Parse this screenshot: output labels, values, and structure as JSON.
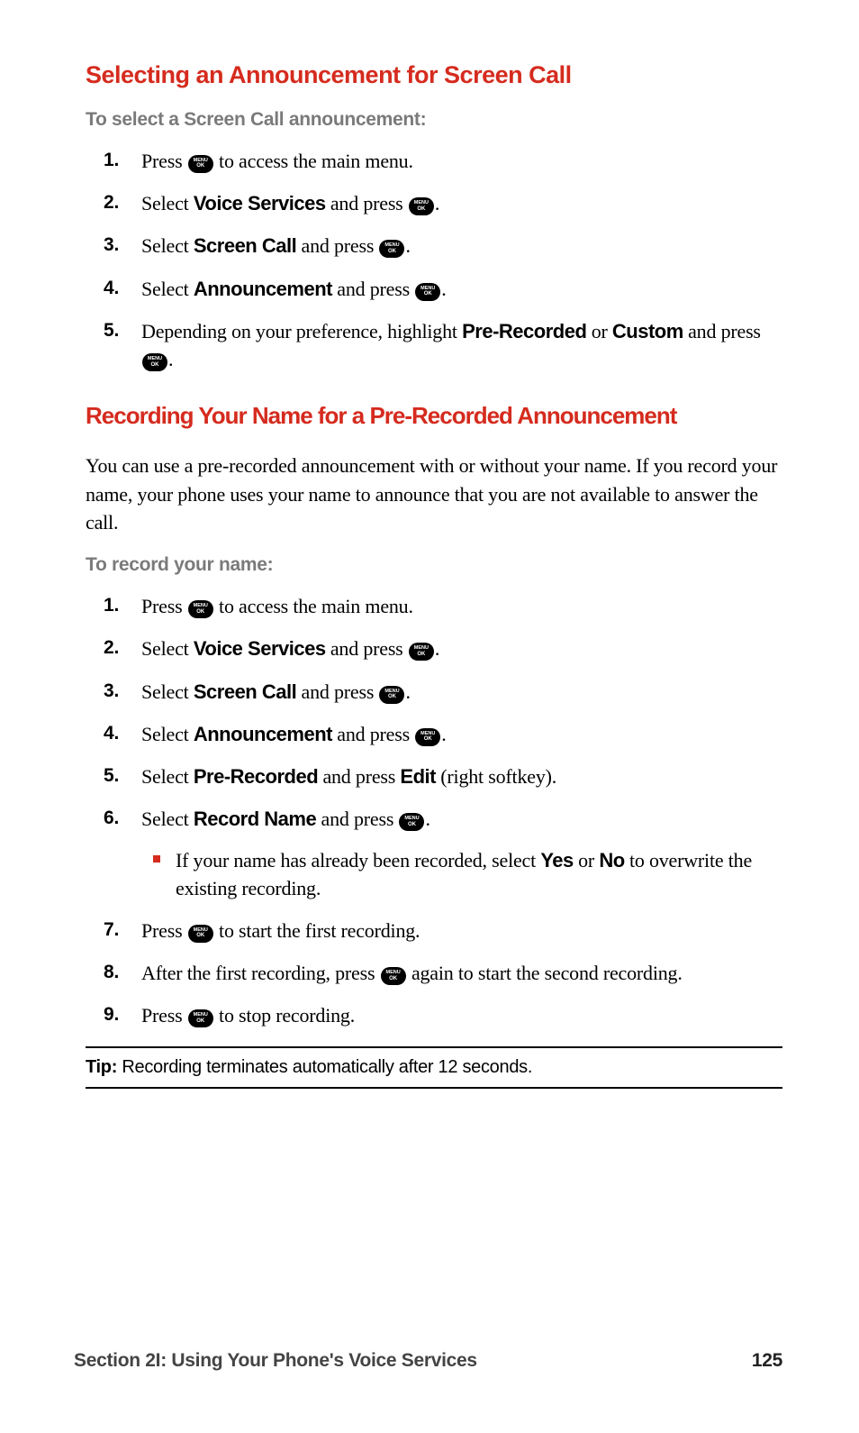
{
  "section1": {
    "heading": "Selecting an Announcement for Screen Call",
    "subhead": "To select a Screen Call announcement:",
    "steps": {
      "s1_a": "Press ",
      "s1_b": " to access the main menu.",
      "s2_a": "Select ",
      "s2_bold": "Voice Services",
      "s2_b": " and press ",
      "s2_c": ".",
      "s3_a": "Select ",
      "s3_bold": "Screen Call",
      "s3_b": " and press ",
      "s3_c": ".",
      "s4_a": "Select ",
      "s4_bold": "Announcement",
      "s4_b": " and press ",
      "s4_c": ".",
      "s5_a": "Depending on your preference, highlight ",
      "s5_bold1": "Pre-Recorded",
      "s5_b": " or ",
      "s5_bold2": "Custom",
      "s5_c": " and press ",
      "s5_d": "."
    }
  },
  "section2": {
    "heading": "Recording Your Name for a Pre-Recorded Announcement",
    "intro": "You can use a pre-recorded announcement with or without your name. If you record your name, your phone uses your name to announce that you are not available to answer the call.",
    "subhead": "To record your name:",
    "steps": {
      "s1_a": "Press ",
      "s1_b": " to access the main menu.",
      "s2_a": "Select ",
      "s2_bold": "Voice Services",
      "s2_b": " and press ",
      "s2_c": ".",
      "s3_a": "Select ",
      "s3_bold": "Screen Call",
      "s3_b": " and press ",
      "s3_c": ".",
      "s4_a": "Select ",
      "s4_bold": "Announcement",
      "s4_b": " and press ",
      "s4_c": ".",
      "s5_a": "Select ",
      "s5_bold1": "Pre-Recorded",
      "s5_b": " and press ",
      "s5_bold2": "Edit",
      "s5_c": " (right softkey).",
      "s6_a": "Select ",
      "s6_bold": "Record Name",
      "s6_b": " and press ",
      "s6_c": ".",
      "bullet_a": "If your name has already been recorded, select ",
      "bullet_bold1": "Yes",
      "bullet_b": " or ",
      "bullet_bold2": "No",
      "bullet_c": " to overwrite the existing recording.",
      "s7_a": "Press ",
      "s7_b": " to start the first recording.",
      "s8_a": "After the first recording, press ",
      "s8_b": " again to start the second recording.",
      "s9_a": "Press ",
      "s9_b": " to stop recording."
    }
  },
  "tip": {
    "label": "Tip:",
    "text": " Recording terminates automatically after 12 seconds."
  },
  "footer": {
    "section": "Section 2I: Using Your Phone's Voice Services",
    "page": "125"
  }
}
